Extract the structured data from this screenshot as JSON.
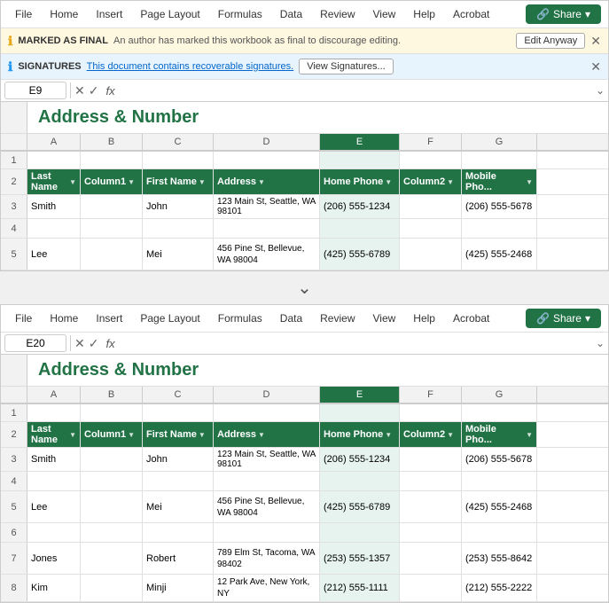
{
  "menubar": {
    "items": [
      "File",
      "Home",
      "Insert",
      "Page Layout",
      "Formulas",
      "Data",
      "Review",
      "View",
      "Help",
      "Acrobat"
    ],
    "share_label": "Share",
    "share_icon": "▾"
  },
  "infobar_marked": {
    "icon": "ℹ",
    "label": "MARKED AS FINAL",
    "text": "An author has marked this workbook as final to discourage editing.",
    "button": "Edit Anyway"
  },
  "infobar_signatures": {
    "icon": "ℹ",
    "label": "SIGNATURES",
    "link_text": "This document contains recoverable signatures.",
    "button": "View Signatures..."
  },
  "formula_bar_top": {
    "cell_ref": "E9",
    "formula": ""
  },
  "formula_bar_bottom": {
    "cell_ref": "E20",
    "formula": ""
  },
  "spreadsheet_title": "Address & Number",
  "columns": {
    "headers": [
      "A",
      "B",
      "C",
      "D",
      "E",
      "F",
      "G"
    ]
  },
  "header_row": {
    "col_a": "Last Name",
    "col_b": "Column1",
    "col_c": "First Name",
    "col_d": "Address",
    "col_e": "Home Phone",
    "col_f": "Column2",
    "col_g": "Mobile Pho..."
  },
  "rows_top": [
    {
      "num": "1",
      "a": "",
      "b": "",
      "c": "",
      "d": "",
      "e": "",
      "f": "",
      "g": ""
    },
    {
      "num": "2",
      "a": "Last Name",
      "b": "Column1",
      "c": "First Name",
      "d": "Address",
      "e": "Home Phone",
      "f": "Column2",
      "g": "Mobile Pho..."
    },
    {
      "num": "3",
      "a": "Smith",
      "b": "",
      "c": "John",
      "d": "123 Main St, Seattle, WA 98101",
      "e": "(206) 555-1234",
      "f": "",
      "g": "(206) 555-5678"
    },
    {
      "num": "4",
      "a": "",
      "b": "",
      "c": "",
      "d": "",
      "e": "",
      "f": "",
      "g": ""
    },
    {
      "num": "5",
      "a": "Lee",
      "b": "",
      "c": "Mei",
      "d": "456 Pine St, Bellevue, WA 98004",
      "e": "(425) 555-6789",
      "f": "",
      "g": "(425) 555-2468"
    }
  ],
  "rows_bottom": [
    {
      "num": "1",
      "a": "",
      "b": "",
      "c": "",
      "d": "",
      "e": "",
      "f": "",
      "g": ""
    },
    {
      "num": "2",
      "a": "Last Name",
      "b": "Column1",
      "c": "First Name",
      "d": "Address",
      "e": "Home Phone",
      "f": "Column2",
      "g": "Mobile Pho..."
    },
    {
      "num": "3",
      "a": "Smith",
      "b": "",
      "c": "John",
      "d": "123 Main St, Seattle, WA 98101",
      "e": "(206) 555-1234",
      "f": "",
      "g": "(206) 555-5678"
    },
    {
      "num": "4",
      "a": "",
      "b": "",
      "c": "",
      "d": "",
      "e": "",
      "f": "",
      "g": ""
    },
    {
      "num": "5",
      "a": "Lee",
      "b": "",
      "c": "Mei",
      "d": "456 Pine St, Bellevue, WA 98004",
      "e": "(425) 555-6789",
      "f": "",
      "g": "(425) 555-2468"
    },
    {
      "num": "6",
      "a": "",
      "b": "",
      "c": "",
      "d": "",
      "e": "",
      "f": "",
      "g": ""
    },
    {
      "num": "7",
      "a": "Jones",
      "b": "",
      "c": "Robert",
      "d": "789 Elm St, Tacoma, WA 98402",
      "e": "(253) 555-1357",
      "f": "",
      "g": "(253) 555-8642"
    },
    {
      "num": "8",
      "a": "Kim",
      "b": "",
      "c": "Minji",
      "d": "12 Park Ave, New York, NY",
      "e": "(212) 555-1111",
      "f": "",
      "g": "(212) 555-2222"
    }
  ],
  "colors": {
    "green": "#217346",
    "active_col_bg": "#e6f3ee",
    "header_bg": "#f2f2f2"
  }
}
